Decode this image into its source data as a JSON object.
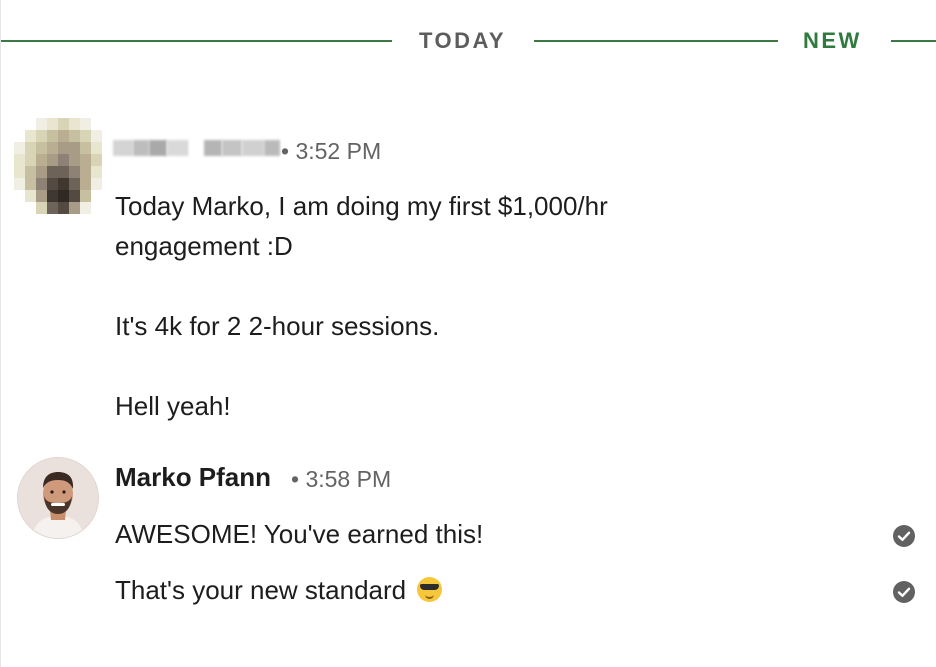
{
  "divider": {
    "today_label": "TODAY",
    "new_label": "NEW",
    "line_color": "#3c7a45"
  },
  "messages": [
    {
      "sender": "",
      "sender_redacted": true,
      "timestamp": "• 3:52 PM",
      "lines": [
        "Today Marko, I am doing my first $1,000/hr",
        "engagement :D",
        "It's 4k for 2 2-hour sessions.",
        "Hell yeah!"
      ]
    },
    {
      "sender": "Marko Pfann",
      "timestamp": "• 3:58 PM",
      "lines": [
        "AWESOME! You've earned this!",
        "That's your new standard"
      ],
      "line_icons": [
        "check-circle-icon",
        "check-circle-icon"
      ],
      "emoji": "smiling-face-with-sunglasses-icon"
    }
  ]
}
